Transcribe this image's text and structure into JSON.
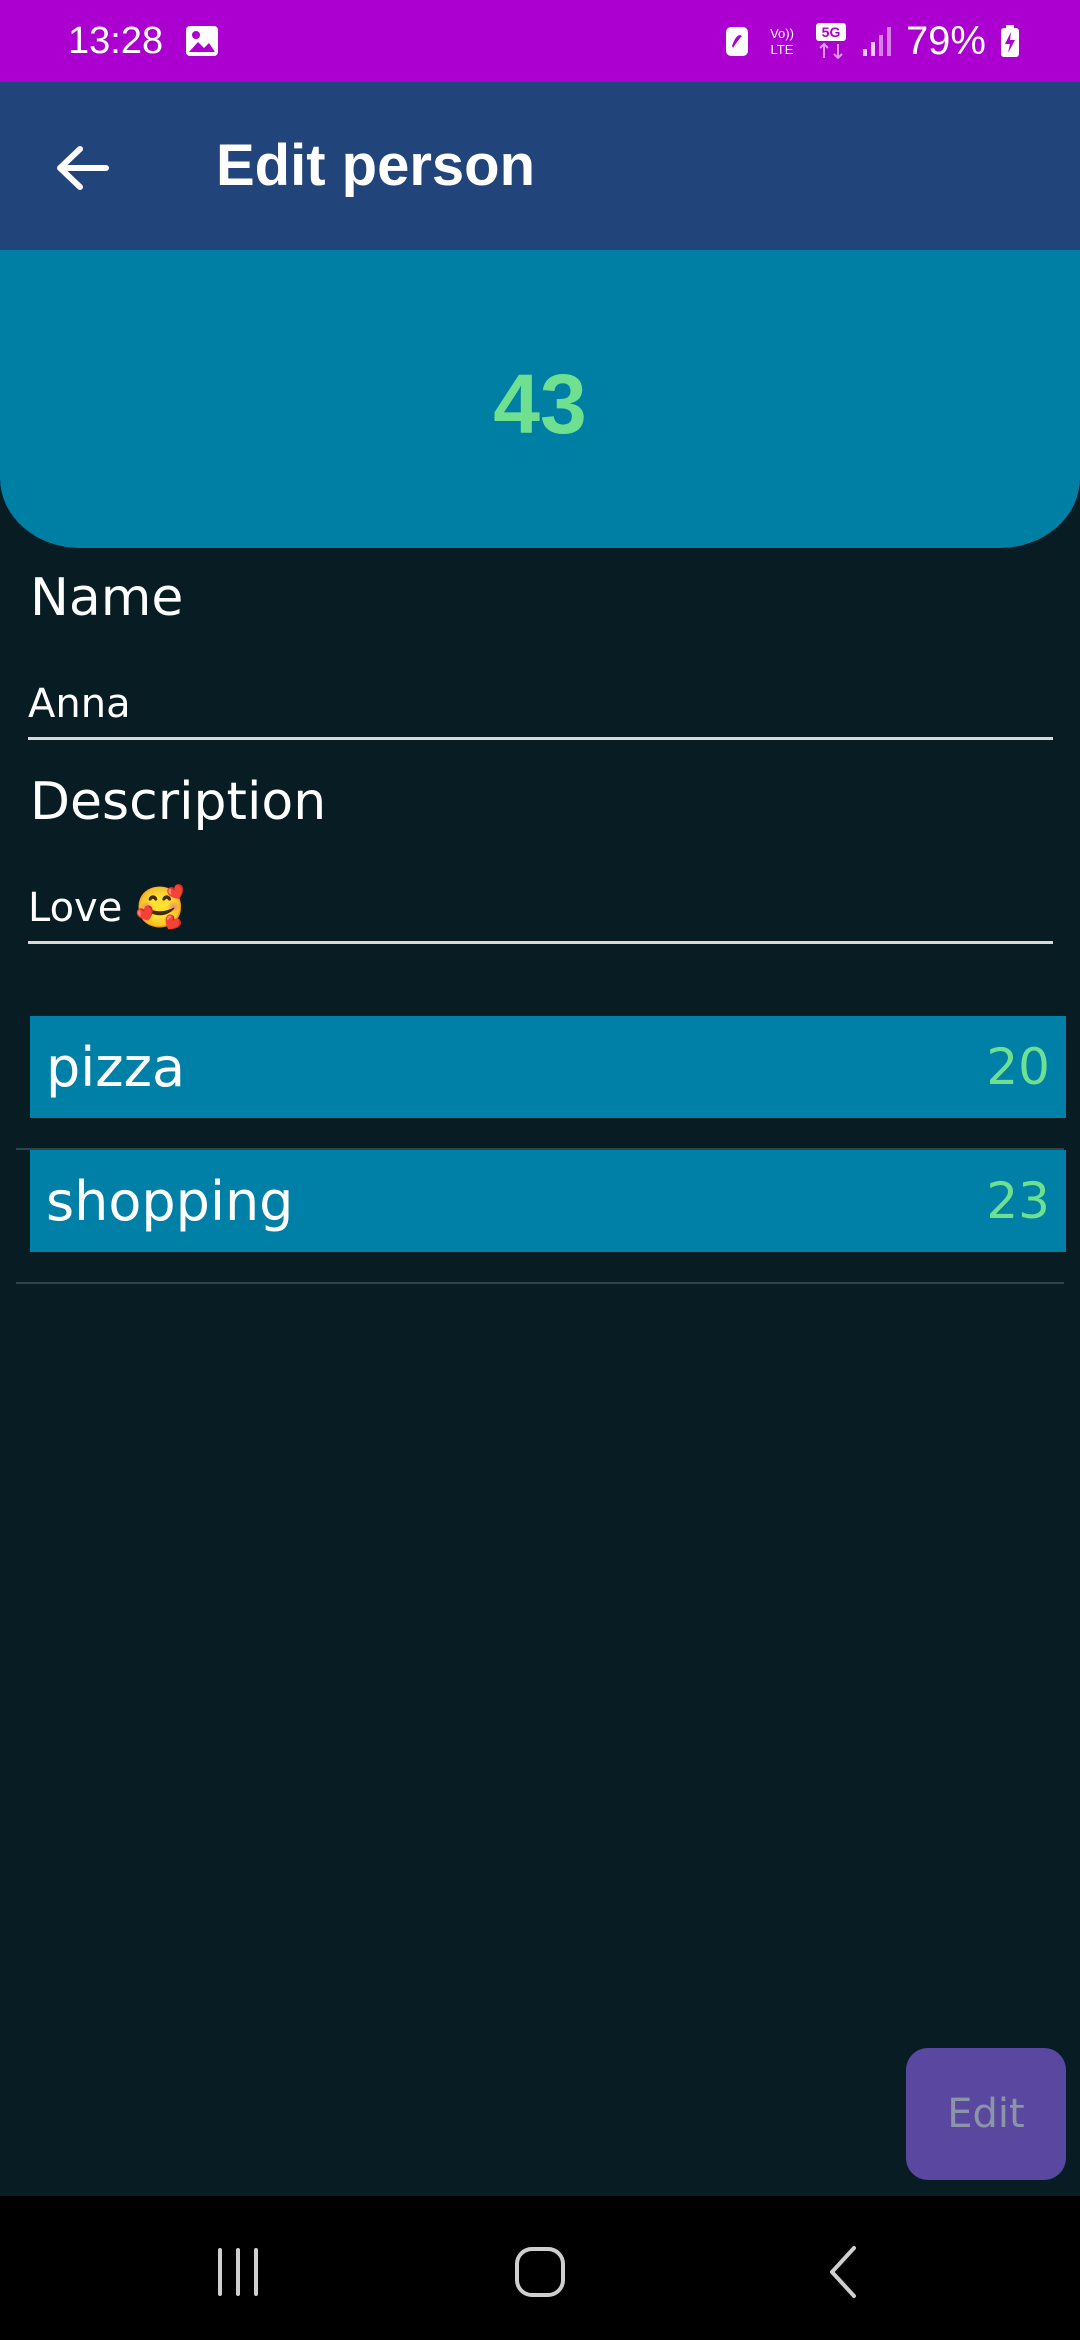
{
  "status_bar": {
    "time": "13:28",
    "battery_percent": "79%",
    "network_label": "5G",
    "volte_label": "Vo)) LTE",
    "icons": [
      "gallery-icon",
      "battery-saver-icon",
      "volte-icon",
      "5g-icon",
      "signal-icon",
      "battery-charging-icon"
    ]
  },
  "app_bar": {
    "title": "Edit person",
    "back_icon": "arrow-left-icon"
  },
  "summary": {
    "total": "43"
  },
  "form": {
    "name_label": "Name",
    "name_value": "Anna",
    "description_label": "Description",
    "description_value": "Love 🥰"
  },
  "tags": [
    {
      "name": "pizza",
      "count": "20"
    },
    {
      "name": "shopping",
      "count": "23"
    }
  ],
  "actions": {
    "edit_label": "Edit"
  },
  "colors": {
    "status_bar": "#ab00cf",
    "app_bar": "#21457a",
    "background": "#071d23",
    "card": "#007fa4",
    "accent_green": "#6fe090",
    "fab": "#5a48a0"
  }
}
